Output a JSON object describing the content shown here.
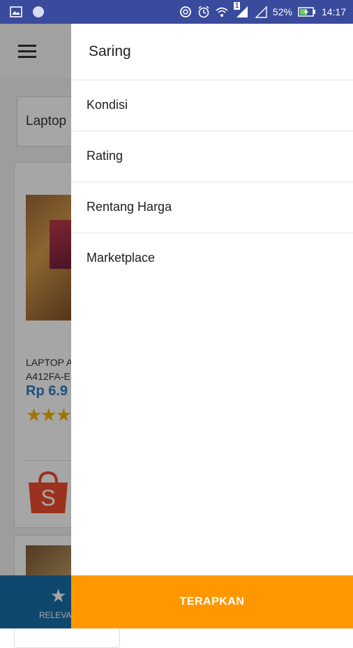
{
  "status_bar": {
    "battery": "52%",
    "time": "14:17",
    "sim_badge": "1",
    "icons": [
      "gallery-icon",
      "circle-notification-icon",
      "sync-icon",
      "alarm-icon",
      "wifi-icon",
      "signal-icon",
      "signal-2-icon",
      "battery-charging-icon"
    ]
  },
  "background_app": {
    "search_text": "Laptop",
    "product": {
      "title_line1": "LAPTOP A",
      "title_line2": "A412FA-E",
      "price": "Rp 6.9",
      "stars": "★★★",
      "store_icon": "shopee-bag-icon",
      "store_letter": "S"
    },
    "bottom_tab_label": "RELEVA"
  },
  "drawer": {
    "title": "Saring",
    "items": [
      {
        "label": "Kondisi"
      },
      {
        "label": "Rating"
      },
      {
        "label": "Rentang Harga"
      },
      {
        "label": "Marketplace"
      }
    ],
    "apply_label": "TERAPKAN"
  },
  "colors": {
    "status_bar": "#3a4a9c",
    "apply_button": "#ff9800",
    "bottom_bar": "#1a6fa8",
    "price": "#2d7cc4"
  }
}
